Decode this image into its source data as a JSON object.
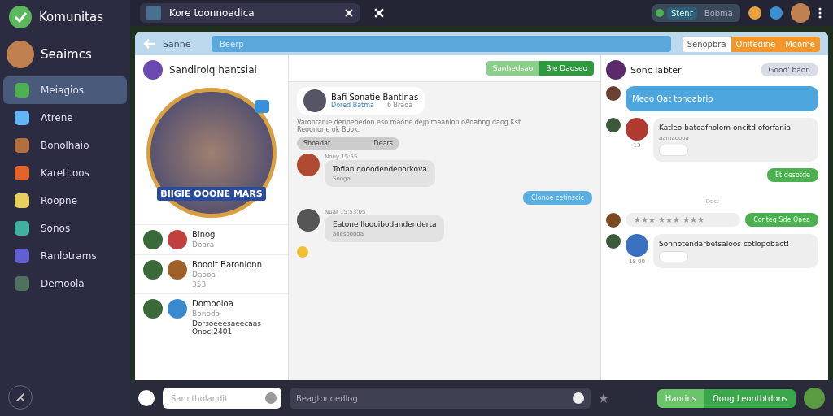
{
  "app": {
    "name": "Komunitas"
  },
  "user": {
    "name": "Seaimcs"
  },
  "nav": [
    {
      "label": "Meiagios",
      "selected": true
    },
    {
      "label": "Atrene",
      "selected": false
    },
    {
      "label": "Bonolhaio",
      "selected": false
    },
    {
      "label": "Kareti.oos",
      "selected": false
    },
    {
      "label": "Roopne",
      "selected": false
    },
    {
      "label": "Sonos",
      "selected": false
    },
    {
      "label": "Ranlotrams",
      "selected": false
    },
    {
      "label": "Demoola",
      "selected": false
    }
  ],
  "tab": {
    "title": "Kore toonnoadica"
  },
  "top_toggle": [
    {
      "label": "Stenr",
      "selected": true
    },
    {
      "label": "Bobma",
      "selected": false
    }
  ],
  "header": {
    "back_label": "Sanne",
    "search": "Beerp",
    "segments": [
      {
        "label": "Senopbra",
        "selected": false
      },
      {
        "label": "Onltedine",
        "selected": true
      },
      {
        "label": "Moome",
        "selected": true
      }
    ]
  },
  "profile": {
    "name": "Sandlrolq hantsiai",
    "banner": "BIIGIE OOONE MARS"
  },
  "contacts": [
    {
      "name": "Binog",
      "sub": "Doara"
    },
    {
      "name": "Boooit Baronlonn",
      "sub": "Daooa",
      "meta": "353"
    },
    {
      "name": "Domooloa",
      "sub": "Bonoda",
      "extra": "Dorsoeeesaeecaas Onoc:2401"
    }
  ],
  "left_search": {
    "placeholder": "Sam tholandit"
  },
  "feed_toggle": [
    {
      "label": "Sanhedsao",
      "selected": false
    },
    {
      "label": "Bie Daoseo",
      "selected": true
    }
  ],
  "post": {
    "name": "Bafi Sonatie Bantinas",
    "link": "Dored Batma",
    "time": "6 Braoa",
    "text": "Varontanie denneoedon eso maone dejp maanlop oAdabng daog Kst Reoonorie ok Book.",
    "pill_left": "Sboadat",
    "pill_right": "Dears"
  },
  "messages": [
    {
      "kind": "incoming",
      "sender": "Nouy 15:55",
      "text": "Tofian dooodendenorkova",
      "sub": "Sooga"
    },
    {
      "kind": "outgoing",
      "text": "Clonoe cetinscic"
    },
    {
      "kind": "incoming",
      "sender": "Nuar 15:53:05",
      "text": "Eatone lloooibodandenderta",
      "sub": "aoesooooa"
    }
  ],
  "composer": {
    "placeholder": "Beagtonoedlog"
  },
  "chat": {
    "title": "Sonc labter",
    "button": "Good' baon",
    "items": [
      {
        "kind": "blue",
        "text": "Meoo Oat tonoabrio"
      },
      {
        "kind": "card",
        "text": "Katleo batoafnolom oncitd oforfania",
        "sub": "aamaoooa",
        "meta": "13"
      },
      {
        "kind": "green",
        "text": "Et desotde"
      },
      {
        "kind": "divider",
        "text": "Oost"
      },
      {
        "kind": "stars",
        "text": "★★★ ★★★ ★★★",
        "reply": "Conteg Sde Oaea"
      },
      {
        "kind": "card",
        "text": "Sonnotendarbetsaloos cotlopobact!",
        "meta": "18 00"
      }
    ]
  },
  "footer_buttons": [
    {
      "label": "Haorins",
      "selected": false
    },
    {
      "label": "Oong Leontbtdons",
      "selected": true
    }
  ]
}
